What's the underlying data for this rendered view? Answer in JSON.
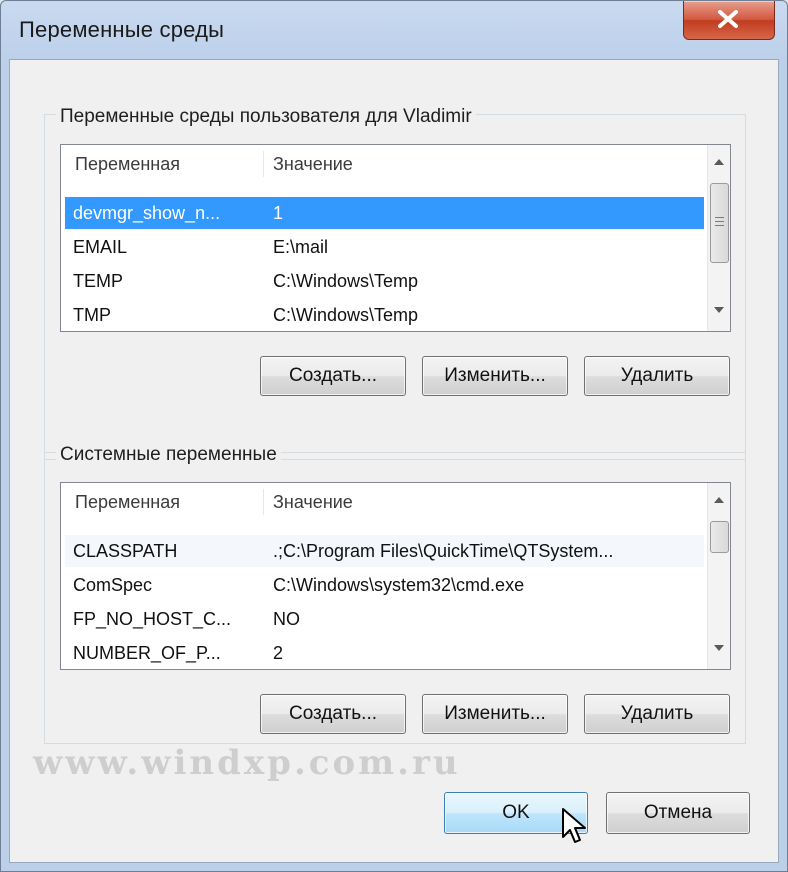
{
  "window": {
    "title": "Переменные среды"
  },
  "user_section": {
    "label": "Переменные среды пользователя для Vladimir",
    "columns": [
      "Переменная",
      "Значение"
    ],
    "rows": [
      {
        "name": "devmgr_show_n...",
        "value": "1",
        "selected": true
      },
      {
        "name": "EMAIL",
        "value": "E:\\mail"
      },
      {
        "name": "TEMP",
        "value": "C:\\Windows\\Temp"
      },
      {
        "name": "TMP",
        "value": "C:\\Windows\\Temp"
      }
    ],
    "buttons": {
      "create": "Создать...",
      "edit": "Изменить...",
      "delete": "Удалить"
    }
  },
  "system_section": {
    "label": "Системные переменные",
    "columns": [
      "Переменная",
      "Значение"
    ],
    "rows": [
      {
        "name": "CLASSPATH",
        "value": ".;C:\\Program Files\\QuickTime\\QTSystem..."
      },
      {
        "name": "ComSpec",
        "value": "C:\\Windows\\system32\\cmd.exe"
      },
      {
        "name": "FP_NO_HOST_C...",
        "value": "NO"
      },
      {
        "name": "NUMBER_OF_P...",
        "value": "2"
      }
    ],
    "buttons": {
      "create": "Создать...",
      "edit": "Изменить...",
      "delete": "Удалить"
    }
  },
  "footer": {
    "ok": "OK",
    "cancel": "Отмена"
  },
  "watermark": "www.windxp.com.ru",
  "colors": {
    "selection": "#3399ff",
    "title_bar": "#bcd0ea",
    "close_button": "#c03b1f"
  }
}
